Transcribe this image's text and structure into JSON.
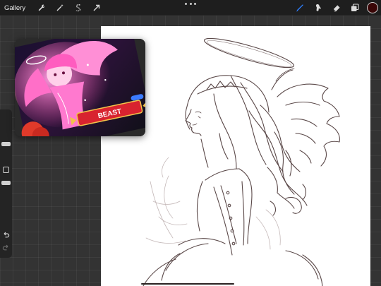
{
  "topbar": {
    "gallery_label": "Gallery",
    "left_tools": [
      "wrench-icon",
      "magic-wand-icon",
      "selection-icon",
      "transform-arrow-icon"
    ],
    "right_tools": [
      "brush-icon",
      "smudge-icon",
      "eraser-icon",
      "layers-icon"
    ],
    "active_tool": "brush-icon",
    "accent_color": "#2f7fff",
    "current_color": "#3a0607"
  },
  "sidebar": {
    "controls": [
      "brush-size-slider",
      "modify-button",
      "opacity-slider",
      "undo-icon",
      "redo-icon"
    ]
  },
  "reference": {
    "badge_text": "BEAST"
  },
  "colors": {
    "workspace": "#333333",
    "canvas": "#ffffff",
    "sketch_line": "#5a4848",
    "ref_pink": "#ff6fc8",
    "ref_red": "#d8232f"
  }
}
